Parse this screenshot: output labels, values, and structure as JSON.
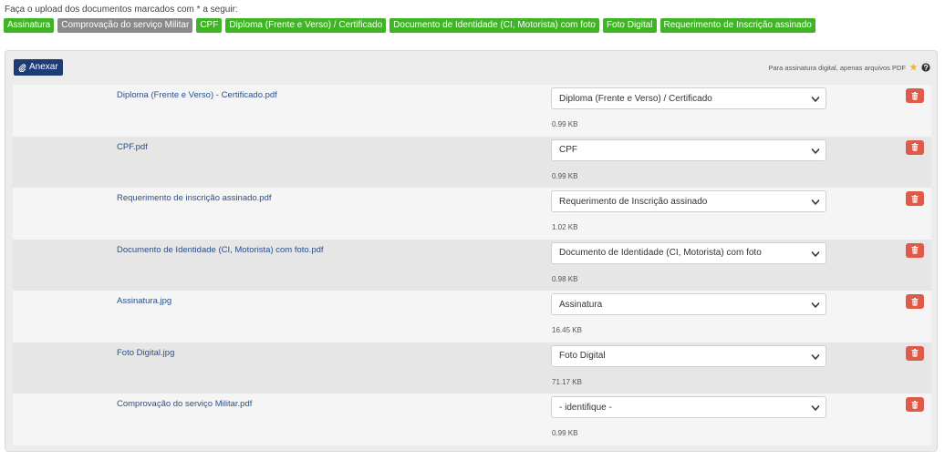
{
  "intro_text": "Faça o upload dos documentos marcados com * a seguir:",
  "tags": [
    {
      "label": "Assinatura",
      "status": "green"
    },
    {
      "label": "Comprovação do serviço Militar",
      "status": "gray"
    },
    {
      "label": "CPF",
      "status": "green"
    },
    {
      "label": "Diploma (Frente e Verso) / Certificado",
      "status": "green"
    },
    {
      "label": "Documento de Identidade (CI, Motorista) com foto",
      "status": "green"
    },
    {
      "label": "Foto Digital",
      "status": "green"
    },
    {
      "label": "Requerimento de Inscrição assinado",
      "status": "green"
    }
  ],
  "toolbar": {
    "attach_label": "Anexar",
    "pdf_note": "Para assinatura digital, apenas arquivos PDF"
  },
  "files": [
    {
      "name": "Diploma (Frente e Verso) - Certificado.pdf",
      "type": "Diploma (Frente e Verso) / Certificado",
      "size": "0.99 KB"
    },
    {
      "name": "CPF.pdf",
      "type": "CPF",
      "size": "0.99 KB"
    },
    {
      "name": "Requerimento de inscrição assinado.pdf",
      "type": "Requerimento de Inscrição assinado",
      "size": "1.02 KB"
    },
    {
      "name": "Documento de Identidade (CI, Motorista) com foto.pdf",
      "type": "Documento de Identidade (CI, Motorista) com foto",
      "size": "0.98 KB"
    },
    {
      "name": "Assinatura.jpg",
      "type": "Assinatura",
      "size": "16.45 KB"
    },
    {
      "name": "Foto Digital.jpg",
      "type": "Foto Digital",
      "size": "71.17 KB"
    },
    {
      "name": "Comprovação do serviço Militar.pdf",
      "type": "- identifique -",
      "size": "0.99 KB"
    }
  ],
  "colors": {
    "tag_done": "#3fb425",
    "tag_pending": "#8a8a8a",
    "attach_button": "#1c3c73",
    "delete_button": "#e05a4a",
    "file_link": "#2a4f8a",
    "star": "#f0b429"
  },
  "icons": {
    "attach": "paperclip-icon",
    "delete": "trash-icon",
    "star": "star-icon",
    "help": "question-icon",
    "select": "chevron-down-icon"
  }
}
